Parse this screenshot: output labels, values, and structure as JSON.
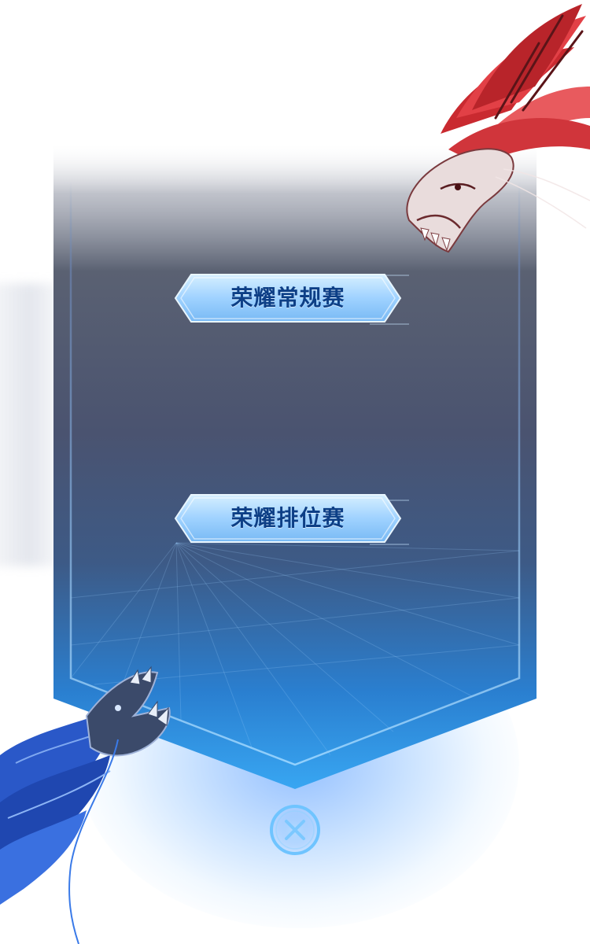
{
  "menu": {
    "buttons": [
      {
        "label": "荣耀常规赛"
      },
      {
        "label": "荣耀排位赛"
      }
    ]
  },
  "close": {
    "icon": "close-icon"
  },
  "decor": {
    "top_right": "red-dragon-art",
    "bottom_left": "blue-dragon-art"
  },
  "colors": {
    "panel_top": "#5b6272",
    "panel_mid": "#4a5470",
    "panel_bottom": "#2a8ce0",
    "button_face": "#a8d8ff",
    "button_text": "#0d3f86",
    "close_ring": "#6fc4ff",
    "red_dragon": "#d8343a",
    "blue_dragon": "#2a58c8"
  }
}
